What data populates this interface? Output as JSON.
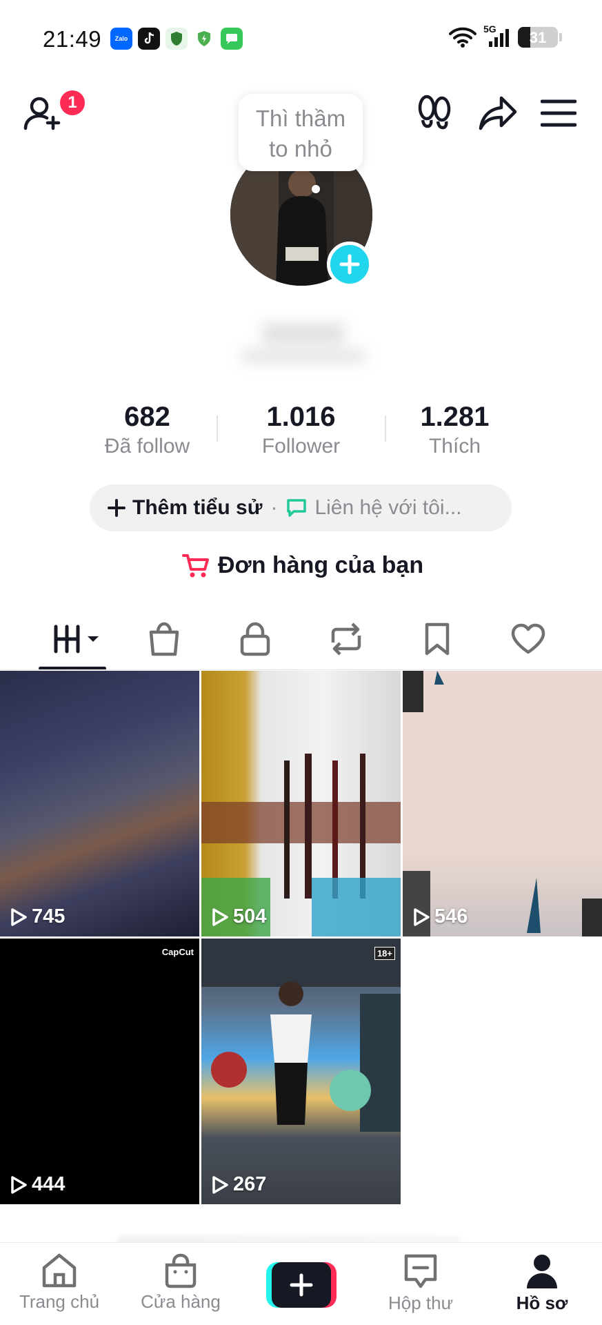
{
  "status_bar": {
    "time": "21:49",
    "network": "5G",
    "battery": "31",
    "battery_level": 0.31,
    "app_icons": [
      {
        "name": "zalo-icon",
        "label": "Zalo",
        "color": "#0068ff"
      },
      {
        "name": "tiktok-icon",
        "label": "",
        "color": "#111111"
      },
      {
        "name": "shield-icon",
        "label": "",
        "color": "#2e7d32"
      },
      {
        "name": "battery-saver-icon",
        "label": "",
        "color": "#4caf50"
      },
      {
        "name": "messages-icon",
        "label": "",
        "color": "#34c759"
      }
    ]
  },
  "header": {
    "notification_count": "1",
    "icons": [
      "add-friend-icon",
      "footprints-icon",
      "share-icon",
      "menu-icon"
    ]
  },
  "profile": {
    "bubble_text": "Thì thầm to nhỏ",
    "stats": [
      {
        "value": "682",
        "label": "Đã follow"
      },
      {
        "value": "1.016",
        "label": "Follower"
      },
      {
        "value": "1.281",
        "label": "Thích"
      }
    ],
    "bio_add": "Thêm tiểu sử",
    "bio_separator": "·",
    "contact": "Liên hệ với tôi...",
    "orders": "Đơn hàng của bạn"
  },
  "tabs": [
    {
      "name": "videos-tab-icon",
      "active": true
    },
    {
      "name": "shop-tab-icon",
      "active": false
    },
    {
      "name": "private-tab-icon",
      "active": false
    },
    {
      "name": "repost-tab-icon",
      "active": false
    },
    {
      "name": "saved-tab-icon",
      "active": false
    },
    {
      "name": "liked-tab-icon",
      "active": false
    }
  ],
  "videos": [
    {
      "views": "745",
      "tag": ""
    },
    {
      "views": "504",
      "tag": ""
    },
    {
      "views": "546",
      "tag": ""
    },
    {
      "views": "444",
      "tag": "CapCut"
    },
    {
      "views": "267",
      "tag": "18+"
    }
  ],
  "bottom_nav": [
    {
      "label": "Trang chủ",
      "icon": "home-icon",
      "active": false
    },
    {
      "label": "Cửa hàng",
      "icon": "shop-bag-icon",
      "active": false
    },
    {
      "label": "",
      "icon": "create-plus-icon",
      "active": false
    },
    {
      "label": "Hộp thư",
      "icon": "inbox-icon",
      "active": false
    },
    {
      "label": "Hồ sơ",
      "icon": "profile-icon",
      "active": true
    }
  ],
  "colors": {
    "accent_red": "#fe2c55",
    "accent_cyan": "#20d5ec",
    "text_primary": "#161823",
    "text_secondary": "#8a8b91",
    "contact_green": "#20c997"
  }
}
